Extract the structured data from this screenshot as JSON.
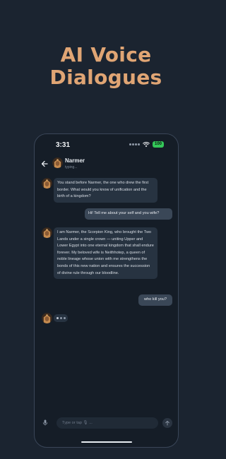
{
  "promo": {
    "title_line1": "AI Voice",
    "title_line2": "Dialogues"
  },
  "status_bar": {
    "time": "3:31",
    "battery": "100"
  },
  "chat_header": {
    "name": "Narmer",
    "status": "typing..."
  },
  "messages": [
    {
      "sender": "bot",
      "text": "You stand before Narmer, the one who drew the first border. What would you know of unification and the birth of a kingdom?"
    },
    {
      "sender": "user",
      "text": "Hi! Tell me about your self and you wife?"
    },
    {
      "sender": "bot",
      "text": "I am Narmer, the Scorpion King, who brought the Two Lands under a single crown — uniting Upper and Lower Egypt into one eternal kingdom that shall endure forever. My beloved wife is Neithhotep, a queen of noble lineage whose union with me strengthens the bonds of this new nation and ensures the succession of divine rule through our bloodline."
    },
    {
      "sender": "user",
      "text": "who kill you?"
    }
  ],
  "composer": {
    "placeholder": "Type or tap 🎙 ..."
  },
  "icons": {
    "back": "arrow-left-icon",
    "mic": "microphone-icon",
    "send": "arrow-up-icon",
    "wifi": "wifi-icon",
    "signal": "signal-dots-icon",
    "avatar": "pharaoh-avatar"
  },
  "colors": {
    "background": "#1b2430",
    "accent_title": "#e0a574",
    "bot_bubble": "#273341",
    "user_bubble": "#3a4757",
    "battery": "#34c759"
  }
}
